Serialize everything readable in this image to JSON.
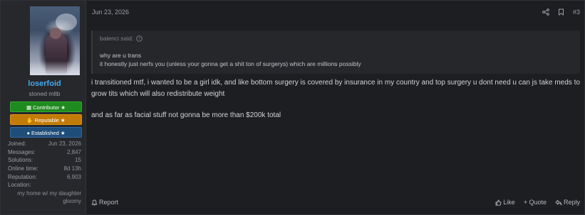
{
  "user": {
    "name": "loserfoid",
    "title": "stoned mltb",
    "badges": [
      {
        "label": "Contributor ★",
        "icon": "contributor-icon"
      },
      {
        "label": "Reputable ★",
        "icon": "handshake-icon"
      },
      {
        "label": "Established ★",
        "icon": "user-icon"
      }
    ],
    "stats": [
      {
        "label": "Joined:",
        "value": "Jun 23, 2026"
      },
      {
        "label": "Messages:",
        "value": "2,847"
      },
      {
        "label": "Solutions:",
        "value": "15"
      },
      {
        "label": "Online time:",
        "value": "8d 13h"
      },
      {
        "label": "Reputation:",
        "value": "6,903"
      }
    ],
    "location_label": "Location:",
    "location_lines": [
      "my home w/ my daughter",
      "gloomy"
    ]
  },
  "post": {
    "date": "Jun 23, 2026",
    "number": "#3",
    "quote": {
      "author": "balenci said:",
      "lines": [
        "why are u trans",
        "it honestly just nerfs you (unless your gonna get a shit ton of surgerys) which are millions possibly"
      ]
    },
    "paragraphs": [
      "i transitioned mtf, i wanted to be a girl idk, and like bottom surgery is covered by insurance in my country and top surgery u dont need u can js take meds to grow tits which will also redistribute weight",
      "and as far as facial stuff not gonna be more than $200k total"
    ]
  },
  "footer": {
    "report": "Report",
    "like": "Like",
    "quote": "+ Quote",
    "reply": "Reply"
  },
  "colors": {
    "username": "#47a7eb",
    "contributor": "#1f8a1f",
    "reputable": "#c27a08",
    "established": "#1f4d7a"
  }
}
